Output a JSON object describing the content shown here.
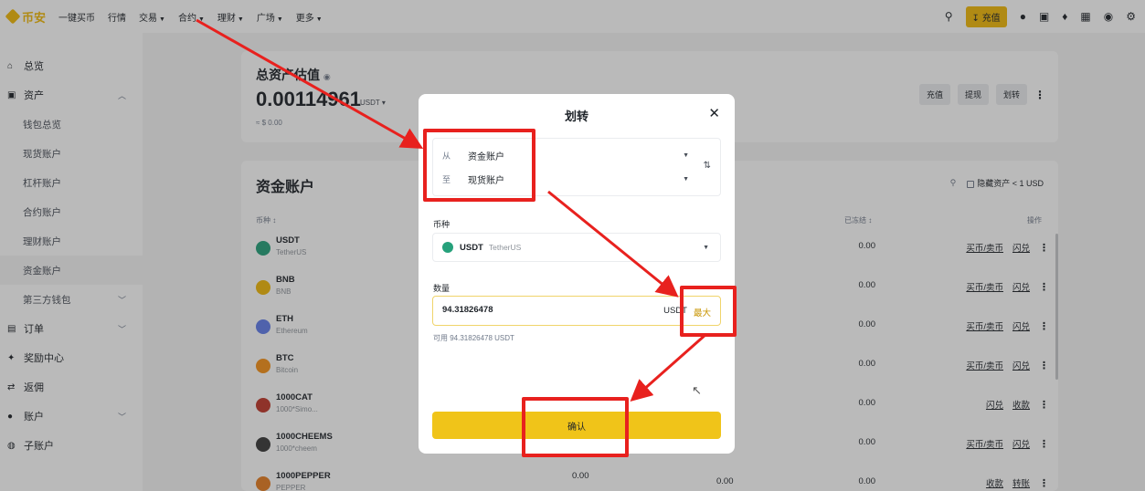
{
  "topnav": {
    "logo": "币安",
    "items": [
      {
        "label": "一键买币",
        "caret": false
      },
      {
        "label": "行情",
        "caret": false
      },
      {
        "label": "交易",
        "caret": true
      },
      {
        "label": "合约",
        "caret": true
      },
      {
        "label": "理财",
        "caret": true
      },
      {
        "label": "广场",
        "caret": true
      },
      {
        "label": "更多",
        "caret": true
      }
    ],
    "deposit_label": "充值",
    "icons": [
      "search-icon",
      "user-icon",
      "wallet-icon",
      "bell-icon",
      "scan-icon",
      "globe-icon",
      "settings-icon"
    ]
  },
  "sidebar": {
    "items": [
      {
        "label": "总览",
        "icon": "home-icon",
        "sub": false,
        "chev": ""
      },
      {
        "label": "资产",
        "icon": "wallet-icon",
        "sub": false,
        "chev": "up"
      },
      {
        "label": "钱包总览",
        "sub": true
      },
      {
        "label": "现货账户",
        "sub": true
      },
      {
        "label": "杠杆账户",
        "sub": true
      },
      {
        "label": "合约账户",
        "sub": true
      },
      {
        "label": "理财账户",
        "sub": true
      },
      {
        "label": "资金账户",
        "sub": true,
        "active": true
      },
      {
        "label": "第三方钱包",
        "sub": true,
        "chev": "down"
      },
      {
        "label": "订单",
        "icon": "order-icon",
        "sub": false,
        "chev": "down"
      },
      {
        "label": "奖励中心",
        "icon": "reward-icon",
        "sub": false
      },
      {
        "label": "返佣",
        "icon": "referral-icon",
        "sub": false
      },
      {
        "label": "账户",
        "icon": "account-icon",
        "sub": false,
        "chev": "down"
      },
      {
        "label": "子账户",
        "icon": "subaccount-icon",
        "sub": false
      }
    ]
  },
  "estimate": {
    "title": "总资产估值",
    "value": "0.00114961",
    "unit": "USDT",
    "fiat": "≈ $ 0.00",
    "actions": [
      "充值",
      "提现",
      "划转"
    ]
  },
  "funding": {
    "title": "资金账户",
    "hide_small": "隐藏资产 < 1 USD",
    "col_coin": "币种",
    "col_frozen": "已冻结",
    "col_action": "操作",
    "rows": [
      {
        "symbol": "USDT",
        "name": "TetherUS",
        "frozen": "0.00",
        "actions": [
          "买币/卖币",
          "闪兑"
        ],
        "color": "#26a17b"
      },
      {
        "symbol": "BNB",
        "name": "BNB",
        "frozen": "0.00",
        "actions": [
          "买币/卖币",
          "闪兑"
        ],
        "color": "#f0b90b"
      },
      {
        "symbol": "ETH",
        "name": "Ethereum",
        "frozen": "0.00",
        "actions": [
          "买币/卖币",
          "闪兑"
        ],
        "color": "#627eea"
      },
      {
        "symbol": "BTC",
        "name": "Bitcoin",
        "frozen": "0.00",
        "actions": [
          "买币/卖币",
          "闪兑"
        ],
        "color": "#f7931a"
      },
      {
        "symbol": "1000CAT",
        "name": "1000*Simo...",
        "frozen": "0.00",
        "actions": [
          "闪兑",
          "收款"
        ],
        "color": "#c0392b"
      },
      {
        "symbol": "1000CHEEMS",
        "name": "1000*cheem",
        "frozen": "0.00",
        "actions": [
          "买币/卖币",
          "闪兑"
        ],
        "color": "#3a3a3a"
      },
      {
        "symbol": "1000PEPPER",
        "name": "PEPPER",
        "mid": "0.00",
        "mid2": "0.00",
        "frozen": "0.00",
        "actions": [
          "收款",
          "转账"
        ],
        "color": "#e67e22"
      }
    ]
  },
  "modal": {
    "title": "划转",
    "from_label": "从",
    "from_value": "资金账户",
    "to_label": "至",
    "to_value": "现货账户",
    "coin_label": "币种",
    "coin_symbol": "USDT",
    "coin_name": "TetherUS",
    "amount_label": "数量",
    "amount_value": "94.31826478",
    "amount_unit": "USDT",
    "max_label": "最大",
    "available": "可用  94.31826478 USDT",
    "confirm_label": "确认"
  },
  "annotation": {
    "color": "#e8211e"
  }
}
